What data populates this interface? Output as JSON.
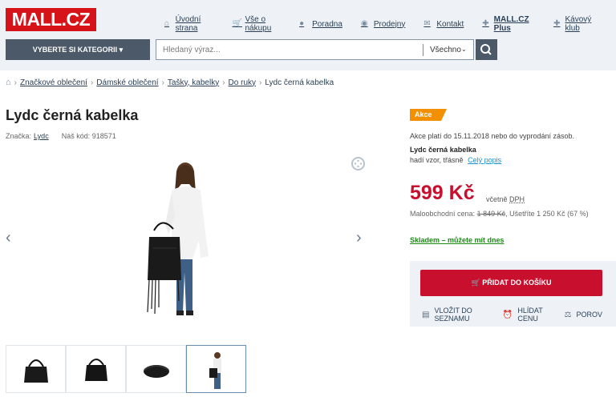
{
  "header": {
    "logo": "MALL.CZ",
    "links": [
      {
        "icon": "home-icon",
        "glyph": "⌂",
        "label": "Úvodní strana",
        "bold": false
      },
      {
        "icon": "cart-icon",
        "glyph": "🛒",
        "label": "Vše o nákupu",
        "bold": false
      },
      {
        "icon": "info-icon",
        "glyph": "●",
        "label": "Poradna",
        "bold": false
      },
      {
        "icon": "location-icon",
        "glyph": "◉",
        "label": "Prodejny",
        "bold": false
      },
      {
        "icon": "mail-icon",
        "glyph": "✉",
        "label": "Kontakt",
        "bold": false
      },
      {
        "icon": "plus-icon",
        "glyph": "✚",
        "label": "MALL.CZ Plus",
        "bold": true
      },
      {
        "icon": "plus-icon",
        "glyph": "✚",
        "label": "Kávový klub",
        "bold": false
      }
    ],
    "category_button": "VYBERTE SI KATEGORII",
    "search": {
      "placeholder": "Hledaný výraz...",
      "scope": "Všechno"
    }
  },
  "breadcrumb": [
    "Značkové oblečení",
    "Dámské oblečení",
    "Tašky, kabelky",
    "Do ruky",
    "Lydc černá kabelka"
  ],
  "product": {
    "title": "Lydc černá kabelka",
    "brand_label": "Značka:",
    "brand": "Lydc",
    "code": "Náš kód: 918571"
  },
  "offer": {
    "badge": "Akce",
    "promo": "Akce platí do 15.11.2018 nebo do vyprodání zásob.",
    "name": "Lydc černá kabelka",
    "desc": "hadí vzor, třásně",
    "desc_link": "Celý popis",
    "price": "599 Kč",
    "vat_prefix": "včetně",
    "vat": "DPH",
    "retail_label": "Maloobchodní cena:",
    "retail_old": "1 849 Kč",
    "savings": ", Ušetříte 1 250 Kč (67 %)",
    "stock": "Skladem – můžete mít dnes",
    "cart_button": "PŘIDAT DO KOŠÍKU",
    "actions": [
      {
        "icon": "list-icon",
        "glyph": "▤",
        "label": "VLOŽIT DO SEZNAMU"
      },
      {
        "icon": "alarm-clock-icon",
        "glyph": "⏰",
        "label": "HLÍDAT CENU"
      },
      {
        "icon": "scales-icon",
        "glyph": "⚖",
        "label": "POROV"
      }
    ]
  },
  "colors": {
    "brand": "#d7131a",
    "header_bg": "#eef2f6",
    "price": "#c8102e",
    "stock": "#1d8a16",
    "badge": "#f29000"
  }
}
